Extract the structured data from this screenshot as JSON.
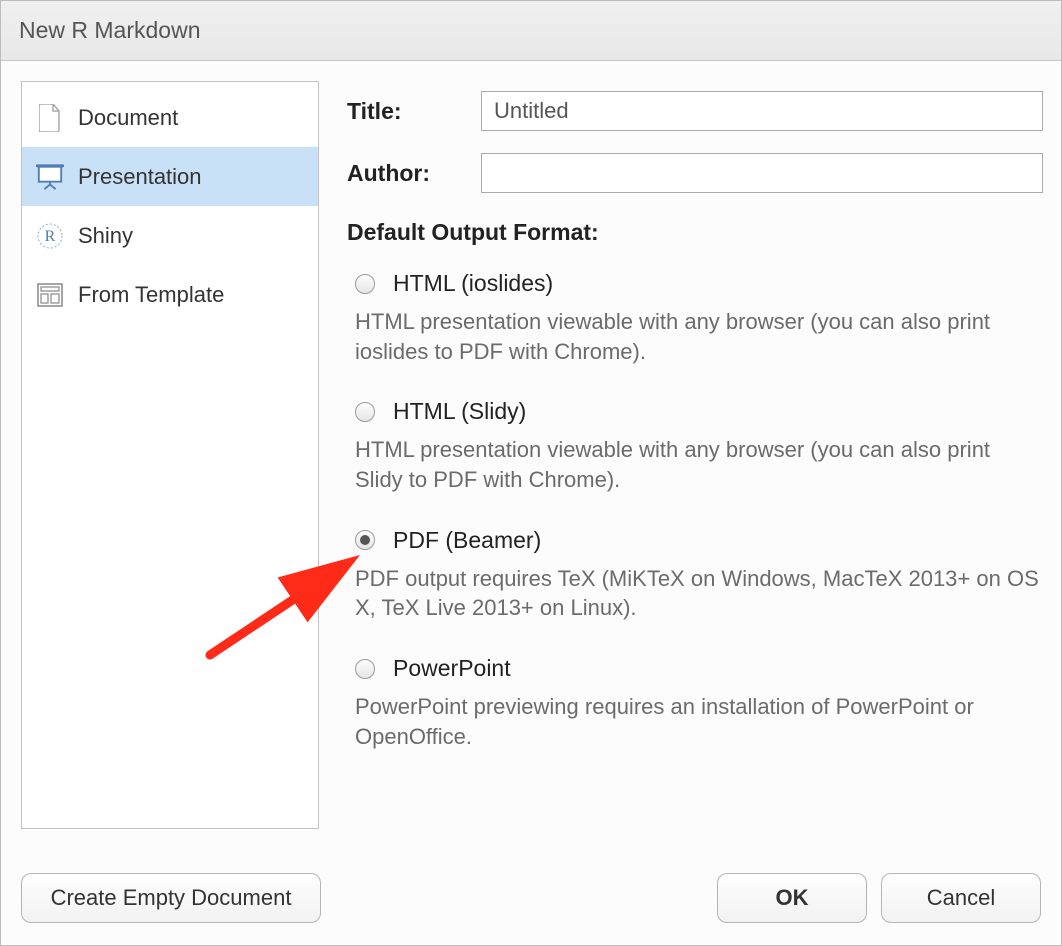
{
  "title": "New R Markdown",
  "sidebar": {
    "items": [
      {
        "label": "Document",
        "selected": false
      },
      {
        "label": "Presentation",
        "selected": true
      },
      {
        "label": "Shiny",
        "selected": false
      },
      {
        "label": "From Template",
        "selected": false
      }
    ]
  },
  "form": {
    "title_label": "Title:",
    "title_value": "Untitled",
    "author_label": "Author:",
    "author_value": ""
  },
  "output_section_label": "Default Output Format:",
  "formats": [
    {
      "label": "HTML (ioslides)",
      "description": "HTML presentation viewable with any browser (you can also print ioslides to PDF with Chrome).",
      "selected": false
    },
    {
      "label": "HTML (Slidy)",
      "description": "HTML presentation viewable with any browser (you can also print Slidy to PDF with Chrome).",
      "selected": false
    },
    {
      "label": "PDF (Beamer)",
      "description": "PDF output requires TeX (MiKTeX on Windows, MacTeX 2013+ on OS X, TeX Live 2013+ on Linux).",
      "selected": true
    },
    {
      "label": "PowerPoint",
      "description": "PowerPoint previewing requires an installation of PowerPoint or OpenOffice.",
      "selected": false
    }
  ],
  "buttons": {
    "create_empty": "Create Empty Document",
    "ok": "OK",
    "cancel": "Cancel"
  }
}
